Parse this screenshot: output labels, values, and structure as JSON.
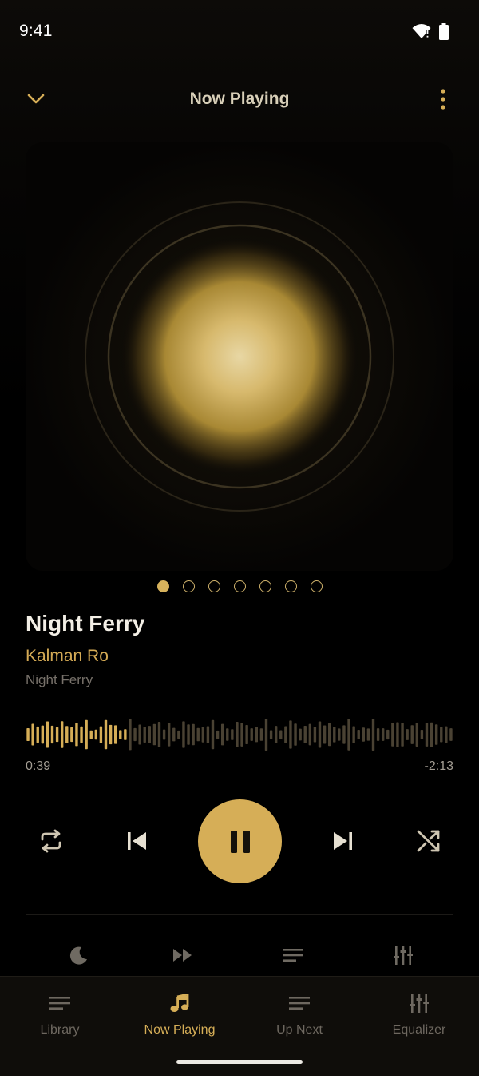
{
  "status_bar": {
    "time": "9:41",
    "icons": [
      "wifi-alert-icon",
      "battery-icon"
    ]
  },
  "app_bar": {
    "title": "Now Playing",
    "left_icon": "chevron-down-icon",
    "right_icon": "more-vertical-icon"
  },
  "artwork": {
    "style": "glowing gold orb with concentric rings",
    "accent": "#d6ae57"
  },
  "pager": {
    "count": 7,
    "active_index": 0
  },
  "track": {
    "title": "Night Ferry",
    "artist": "Kalman Ro",
    "album": "Night Ferry"
  },
  "progress": {
    "elapsed": "0:39",
    "remaining": "-2:13",
    "fraction_played": 0.23
  },
  "controls": {
    "repeat_icon": "repeat-icon",
    "previous_icon": "skip-previous-icon",
    "play_pause_icon": "pause-icon",
    "next_icon": "skip-next-icon",
    "shuffle_icon": "shuffle-icon"
  },
  "secondary_actions": [
    {
      "icon": "sleep-timer-moon-icon"
    },
    {
      "icon": "playback-speed-icon"
    },
    {
      "icon": "lyrics-lines-icon"
    },
    {
      "icon": "equalizer-sliders-icon"
    }
  ],
  "bottom_nav": {
    "items": [
      {
        "label": "Library",
        "icon": "library-lines-icon",
        "active": false
      },
      {
        "label": "Now Playing",
        "icon": "music-note-icon",
        "active": true
      },
      {
        "label": "Up Next",
        "icon": "queue-lines-icon",
        "active": false
      },
      {
        "label": "Equalizer",
        "icon": "equalizer-sliders-icon",
        "active": false
      }
    ]
  },
  "colors": {
    "accent": "#d6ae57",
    "background": "#000000",
    "muted_text": "#77716a",
    "nav_background": "#0f0d0a"
  }
}
